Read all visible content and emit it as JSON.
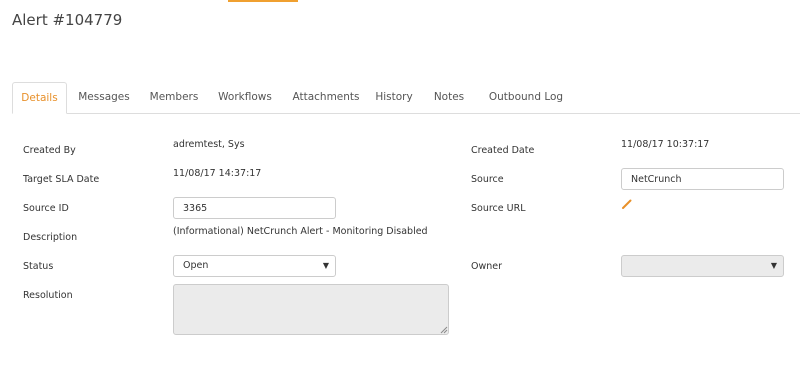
{
  "page": {
    "title": "Alert #104779"
  },
  "tabs": [
    {
      "label": "Details",
      "active": true
    },
    {
      "label": "Messages"
    },
    {
      "label": "Members"
    },
    {
      "label": "Workflows"
    },
    {
      "label": "Attachments"
    },
    {
      "label": "History"
    },
    {
      "label": "Notes"
    },
    {
      "label": "Outbound Log"
    }
  ],
  "fields": {
    "created_by": {
      "label": "Created By",
      "value": "adremtest, Sys"
    },
    "created_date": {
      "label": "Created Date",
      "value": "11/08/17 10:37:17"
    },
    "target_sla_date": {
      "label": "Target SLA Date",
      "value": "11/08/17 14:37:17"
    },
    "source": {
      "label": "Source",
      "value": "NetCrunch"
    },
    "source_id": {
      "label": "Source ID",
      "value": "3365"
    },
    "source_url": {
      "label": "Source URL",
      "icon": "pencil-icon"
    },
    "description": {
      "label": "Description",
      "value": "(Informational) NetCrunch Alert - Monitoring Disabled"
    },
    "status": {
      "label": "Status",
      "value": "Open"
    },
    "owner": {
      "label": "Owner",
      "value": ""
    },
    "resolution": {
      "label": "Resolution",
      "value": ""
    }
  },
  "colors": {
    "accent": "#e8902a",
    "disabled_bg": "#ebebeb",
    "border": "#cccccc"
  }
}
